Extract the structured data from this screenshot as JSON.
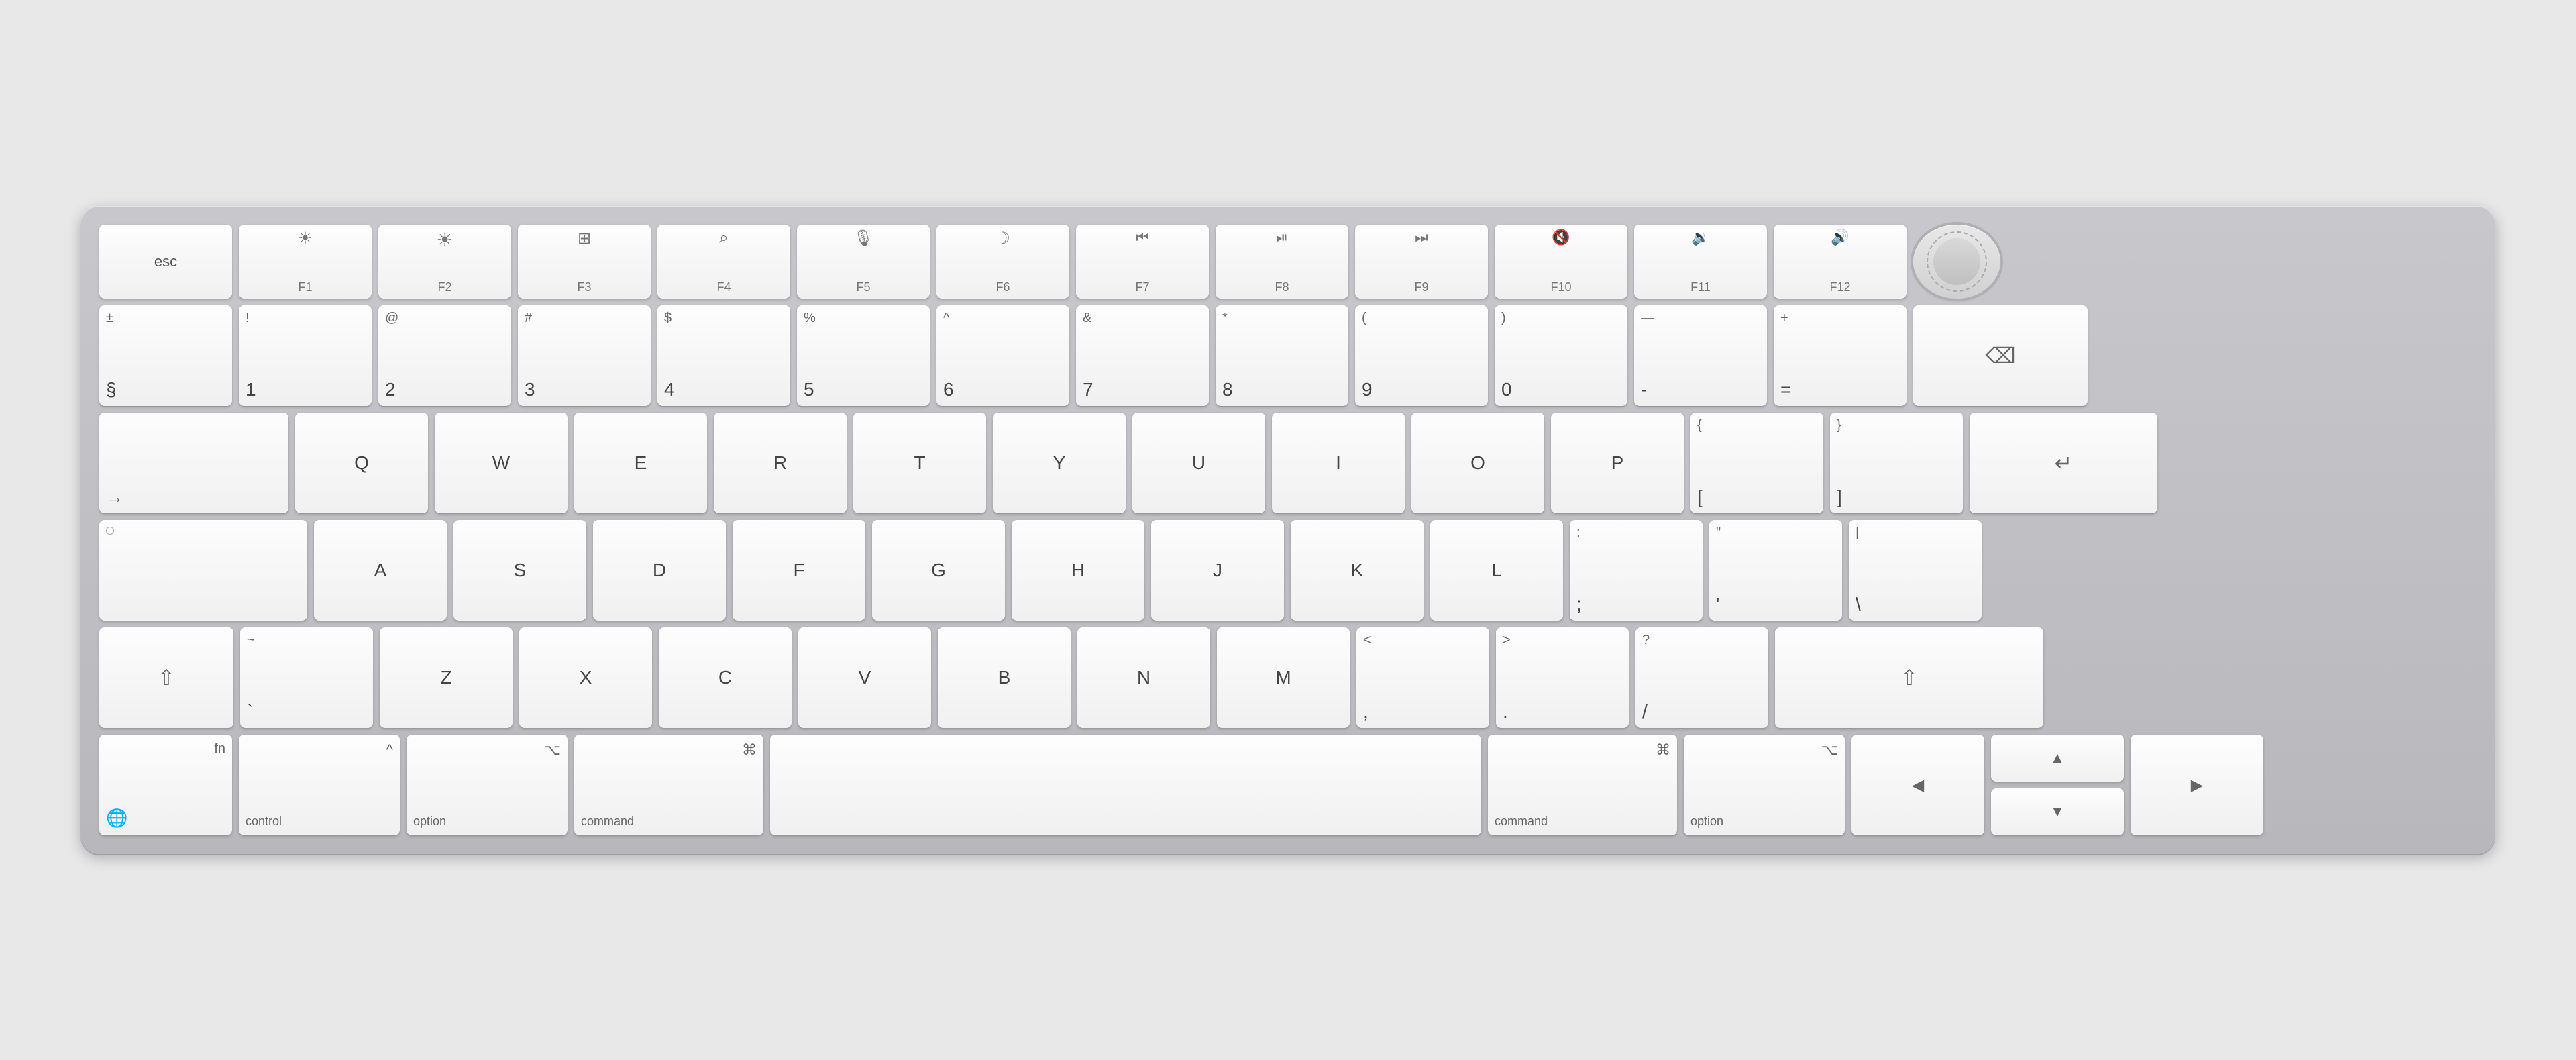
{
  "keyboard": {
    "rows": {
      "row_fn": {
        "keys": [
          {
            "id": "esc",
            "label": "esc",
            "type": "esc"
          },
          {
            "id": "f1",
            "label": "F1",
            "icon": "☀",
            "type": "fn"
          },
          {
            "id": "f2",
            "label": "F2",
            "icon": "☀",
            "type": "fn"
          },
          {
            "id": "f3",
            "label": "F3",
            "icon": "⊞",
            "type": "fn"
          },
          {
            "id": "f4",
            "label": "F4",
            "icon": "⌕",
            "type": "fn"
          },
          {
            "id": "f5",
            "label": "F5",
            "icon": "🎤",
            "type": "fn"
          },
          {
            "id": "f6",
            "label": "F6",
            "icon": "☽",
            "type": "fn"
          },
          {
            "id": "f7",
            "label": "F7",
            "icon": "⏮",
            "type": "fn"
          },
          {
            "id": "f8",
            "label": "F8",
            "icon": "⏯",
            "type": "fn"
          },
          {
            "id": "f9",
            "label": "F9",
            "icon": "⏭",
            "type": "fn"
          },
          {
            "id": "f10",
            "label": "F10",
            "icon": "🔇",
            "type": "fn"
          },
          {
            "id": "f11",
            "label": "F11",
            "icon": "🔉",
            "type": "fn"
          },
          {
            "id": "f12",
            "label": "F12",
            "icon": "🔊",
            "type": "fn"
          },
          {
            "id": "touchid",
            "label": "",
            "type": "touchid"
          }
        ]
      },
      "row_num": {
        "keys": [
          {
            "id": "backtick",
            "top": "±",
            "bottom": "§",
            "type": "double"
          },
          {
            "id": "1",
            "top": "!",
            "bottom": "1",
            "type": "double"
          },
          {
            "id": "2",
            "top": "@",
            "bottom": "2",
            "type": "double"
          },
          {
            "id": "3",
            "top": "#",
            "bottom": "3",
            "type": "double"
          },
          {
            "id": "4",
            "top": "$",
            "bottom": "4",
            "type": "double"
          },
          {
            "id": "5",
            "top": "%",
            "bottom": "5",
            "type": "double"
          },
          {
            "id": "6",
            "top": "^",
            "bottom": "6",
            "type": "double"
          },
          {
            "id": "7",
            "top": "&",
            "bottom": "7",
            "type": "double"
          },
          {
            "id": "8",
            "top": "*",
            "bottom": "8",
            "type": "double"
          },
          {
            "id": "9",
            "top": "(",
            "bottom": "9",
            "type": "double"
          },
          {
            "id": "0",
            "top": ")",
            "bottom": "0",
            "type": "double"
          },
          {
            "id": "minus",
            "top": "—",
            "bottom": "-",
            "type": "double"
          },
          {
            "id": "equals",
            "top": "+",
            "bottom": "=",
            "type": "double"
          },
          {
            "id": "backspace",
            "label": "⌫",
            "type": "backspace"
          }
        ]
      },
      "row_qwerty": {
        "keys": [
          {
            "id": "tab",
            "label": "→",
            "type": "tab"
          },
          {
            "id": "q",
            "bottom": "Q",
            "type": "letter"
          },
          {
            "id": "w",
            "bottom": "W",
            "type": "letter"
          },
          {
            "id": "e",
            "bottom": "E",
            "type": "letter"
          },
          {
            "id": "r",
            "bottom": "R",
            "type": "letter"
          },
          {
            "id": "t",
            "bottom": "T",
            "type": "letter"
          },
          {
            "id": "y",
            "bottom": "Y",
            "type": "letter"
          },
          {
            "id": "u",
            "bottom": "U",
            "type": "letter"
          },
          {
            "id": "i",
            "bottom": "I",
            "type": "letter"
          },
          {
            "id": "o",
            "bottom": "O",
            "type": "letter"
          },
          {
            "id": "p",
            "bottom": "P",
            "type": "letter"
          },
          {
            "id": "bracket_l",
            "top": "{",
            "bottom": "[",
            "type": "double"
          },
          {
            "id": "bracket_r",
            "top": "}",
            "bottom": "]",
            "type": "double"
          },
          {
            "id": "return",
            "label": "↵",
            "type": "return"
          }
        ]
      },
      "row_asdf": {
        "keys": [
          {
            "id": "caps",
            "top": "•",
            "label": "",
            "type": "caps"
          },
          {
            "id": "a",
            "bottom": "A",
            "type": "letter"
          },
          {
            "id": "s",
            "bottom": "S",
            "type": "letter"
          },
          {
            "id": "d",
            "bottom": "D",
            "type": "letter"
          },
          {
            "id": "f",
            "bottom": "F",
            "type": "letter"
          },
          {
            "id": "g",
            "bottom": "G",
            "type": "letter"
          },
          {
            "id": "h",
            "bottom": "H",
            "type": "letter"
          },
          {
            "id": "j",
            "bottom": "J",
            "type": "letter"
          },
          {
            "id": "k",
            "bottom": "K",
            "type": "letter"
          },
          {
            "id": "l",
            "bottom": "L",
            "type": "letter"
          },
          {
            "id": "semicolon",
            "top": ":",
            "bottom": ";",
            "type": "double"
          },
          {
            "id": "quote",
            "top": "\"",
            "bottom": "'",
            "type": "double"
          },
          {
            "id": "backslash",
            "top": "|",
            "bottom": "\\",
            "type": "double"
          }
        ]
      },
      "row_zxcv": {
        "keys": [
          {
            "id": "shift_l",
            "label": "⇧",
            "type": "shift_l"
          },
          {
            "id": "backtick2",
            "top": "~",
            "bottom": "`",
            "type": "double"
          },
          {
            "id": "z",
            "bottom": "Z",
            "type": "letter"
          },
          {
            "id": "x",
            "bottom": "X",
            "type": "letter"
          },
          {
            "id": "c",
            "bottom": "C",
            "type": "letter"
          },
          {
            "id": "v",
            "bottom": "V",
            "type": "letter"
          },
          {
            "id": "b",
            "bottom": "B",
            "type": "letter"
          },
          {
            "id": "n",
            "bottom": "N",
            "type": "letter"
          },
          {
            "id": "m",
            "bottom": "M",
            "type": "letter"
          },
          {
            "id": "comma",
            "top": "<",
            "bottom": ",",
            "type": "double"
          },
          {
            "id": "period",
            "top": ">",
            "bottom": ".",
            "type": "double"
          },
          {
            "id": "slash",
            "top": "?",
            "bottom": "/",
            "type": "double"
          },
          {
            "id": "shift_r",
            "label": "⇧",
            "type": "shift_r"
          }
        ]
      },
      "row_bottom": {
        "keys": [
          {
            "id": "globe",
            "top": "fn",
            "bottom": "🌐",
            "type": "modifier"
          },
          {
            "id": "ctrl",
            "top": "^",
            "bottom": "control",
            "type": "modifier"
          },
          {
            "id": "opt_l",
            "top": "⌥",
            "bottom": "option",
            "type": "modifier"
          },
          {
            "id": "cmd_l",
            "top": "⌘",
            "bottom": "command",
            "type": "modifier"
          },
          {
            "id": "space",
            "label": "",
            "type": "space"
          },
          {
            "id": "cmd_r",
            "top": "⌘",
            "bottom": "command",
            "type": "modifier"
          },
          {
            "id": "opt_r",
            "top": "⌥",
            "bottom": "option",
            "type": "modifier"
          },
          {
            "id": "arrow_left",
            "label": "◀",
            "type": "arrow"
          },
          {
            "id": "arrow_up",
            "label": "▲",
            "type": "arrow_up"
          },
          {
            "id": "arrow_down",
            "label": "▼",
            "type": "arrow_down"
          },
          {
            "id": "arrow_right",
            "label": "▶",
            "type": "arrow"
          }
        ]
      }
    }
  }
}
